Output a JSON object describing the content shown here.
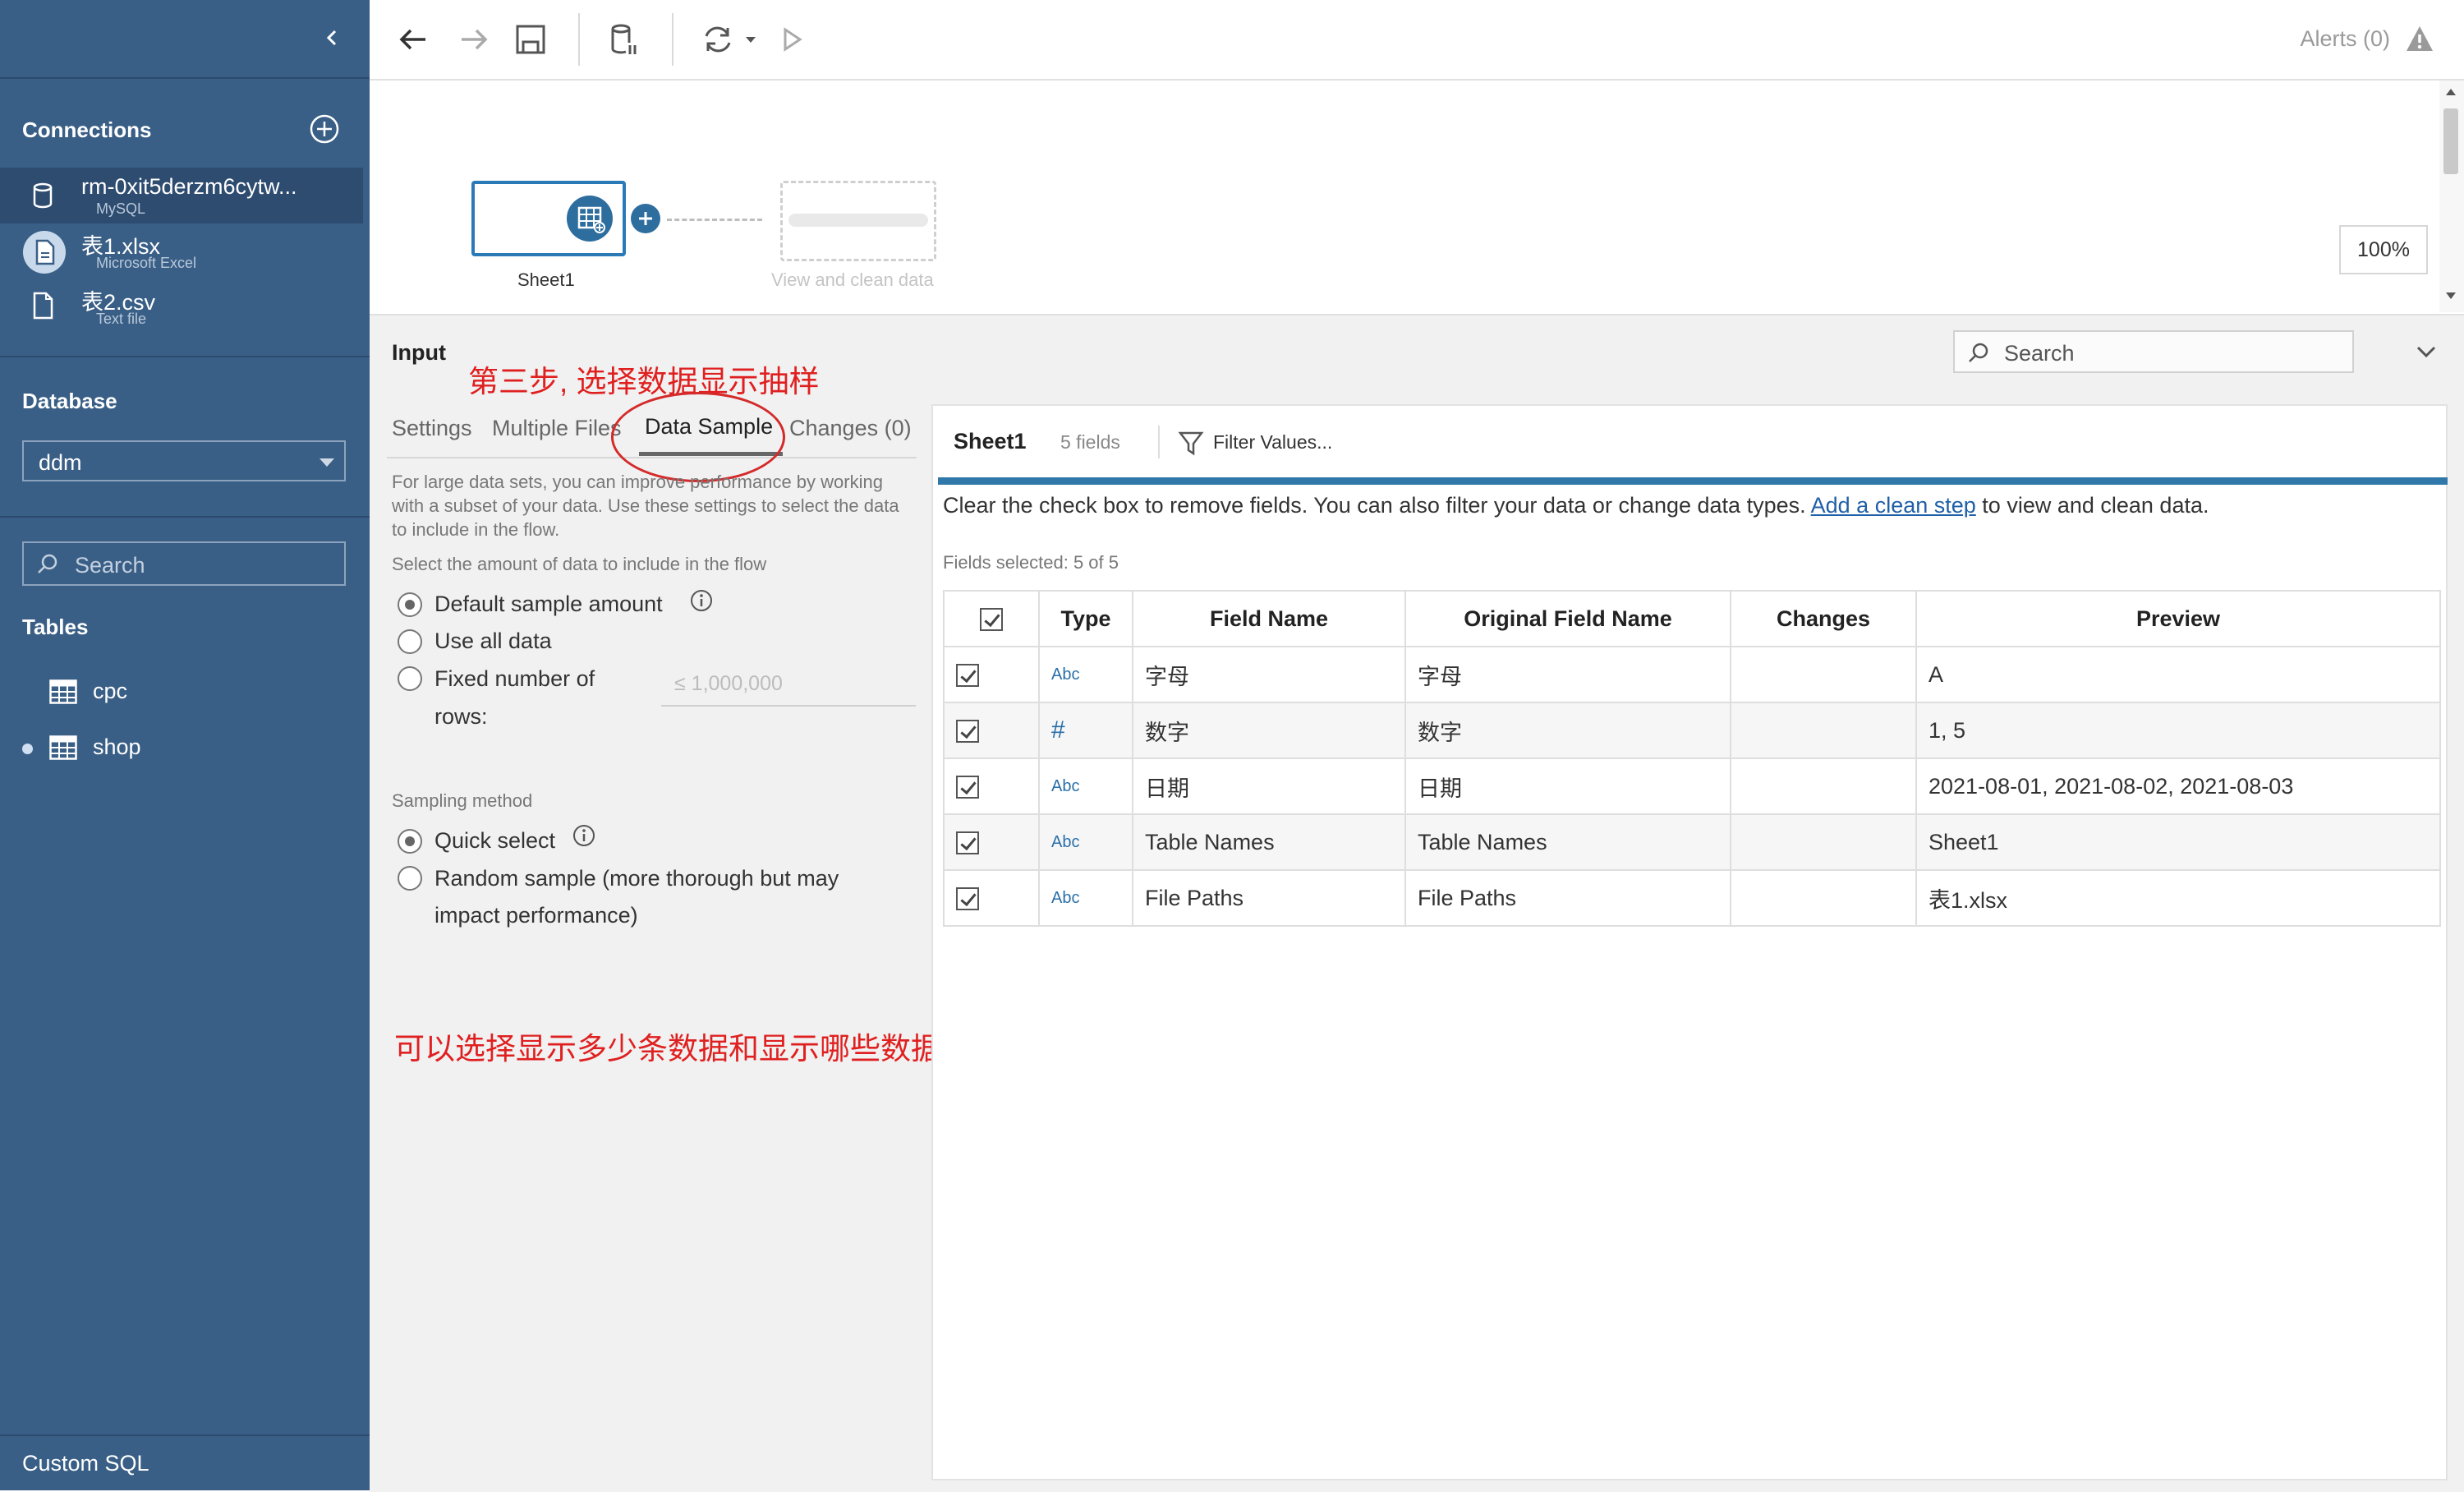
{
  "sidebar": {
    "connections_heading": "Connections",
    "connections": [
      {
        "name": "rm-0xit5derzm6cytw...",
        "type": "MySQL",
        "icon": "database-icon",
        "active": true
      },
      {
        "name": "表1.xlsx",
        "type": "Microsoft Excel",
        "icon": "excel-file-icon",
        "active": false
      },
      {
        "name": "表2.csv",
        "type": "Text file",
        "icon": "text-file-icon",
        "active": false
      }
    ],
    "database_heading": "Database",
    "database_value": "ddm",
    "search_placeholder": "Search",
    "tables_heading": "Tables",
    "tables": [
      {
        "name": "cpc",
        "selected": false
      },
      {
        "name": "shop",
        "selected": true
      }
    ],
    "custom_sql": "Custom SQL"
  },
  "toolbar": {
    "alerts": "Alerts (0)"
  },
  "canvas": {
    "node_label": "Sheet1",
    "ghost_label": "View and clean data",
    "zoom": "100%"
  },
  "input_panel": {
    "title": "Input",
    "search_placeholder": "Search",
    "tabs": [
      "Settings",
      "Multiple Files",
      "Data Sample",
      "Changes (0)"
    ],
    "active_tab": "Data Sample",
    "description": "For large data sets, you can improve performance by working with a subset of your data. Use these settings to select the data to include in the flow.",
    "amount_label": "Select the amount of data to include in the flow",
    "amount_options": [
      "Default sample amount",
      "Use all data",
      "Fixed number of",
      "rows:"
    ],
    "rows_placeholder": "≤ 1,000,000",
    "sampling_label": "Sampling method",
    "sampling_options": [
      "Quick select",
      "Random sample (more thorough but may",
      "impact performance)"
    ]
  },
  "annotations": {
    "step3": "第三步, 选择数据显示抽样",
    "note": "可以选择显示多少条数据和显示哪些数据"
  },
  "grid": {
    "sheet": "Sheet1",
    "field_count": "5 fields",
    "filter": "Filter Values...",
    "info_before": "Clear the check box to remove fields. You can also filter your data or change data types. ",
    "info_link": "Add a clean step",
    "info_after": " to view and clean data.",
    "fields_selected": "Fields selected: 5 of 5",
    "headers": {
      "type": "Type",
      "field": "Field Name",
      "original": "Original Field Name",
      "changes": "Changes",
      "preview": "Preview"
    },
    "rows": [
      {
        "type": "Abc",
        "field": "字母",
        "original": "字母",
        "changes": "",
        "preview": "A"
      },
      {
        "type": "#",
        "field": "数字",
        "original": "数字",
        "changes": "",
        "preview": "1, 5"
      },
      {
        "type": "Abc",
        "field": "日期",
        "original": "日期",
        "changes": "",
        "preview": "2021-08-01, 2021-08-02, 2021-08-03"
      },
      {
        "type": "Abc",
        "field": "Table Names",
        "original": "Table Names",
        "changes": "",
        "preview": "Sheet1"
      },
      {
        "type": "Abc",
        "field": "File Paths",
        "original": "File Paths",
        "changes": "",
        "preview": "表1.xlsx"
      }
    ]
  },
  "colors": {
    "sidebar": "#3a5f86",
    "accent": "#2f78a9",
    "annotation": "#e02020"
  }
}
